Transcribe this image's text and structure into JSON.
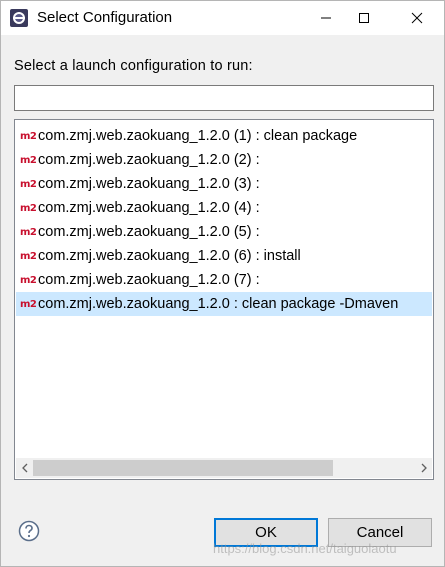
{
  "window": {
    "title": "Select Configuration"
  },
  "prompt": "Select a launch configuration to run:",
  "filter": {
    "value": "",
    "placeholder": ""
  },
  "icon_label": "m2",
  "configurations": [
    "com.zmj.web.zaokuang_1.2.0 (1) : clean package",
    "com.zmj.web.zaokuang_1.2.0 (2) :",
    "com.zmj.web.zaokuang_1.2.0 (3) :",
    "com.zmj.web.zaokuang_1.2.0 (4) :",
    "com.zmj.web.zaokuang_1.2.0 (5) :",
    "com.zmj.web.zaokuang_1.2.0 (6) : install",
    "com.zmj.web.zaokuang_1.2.0 (7) :",
    "com.zmj.web.zaokuang_1.2.0 : clean package -Dmaven"
  ],
  "selected_index": 7,
  "buttons": {
    "ok": "OK",
    "cancel": "Cancel"
  },
  "watermark": "https://blog.csdn.net/taiguolaotu",
  "colors": {
    "selection": "#cce8ff",
    "m2_icon": "#c8102e",
    "default_button_border": "#0078d7"
  }
}
